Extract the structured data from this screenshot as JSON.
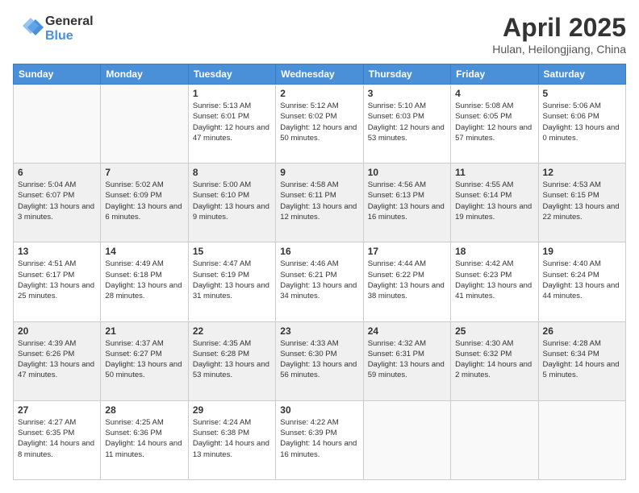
{
  "header": {
    "logo": {
      "general": "General",
      "blue": "Blue"
    },
    "title": "April 2025",
    "location": "Hulan, Heilongjiang, China"
  },
  "days_of_week": [
    "Sunday",
    "Monday",
    "Tuesday",
    "Wednesday",
    "Thursday",
    "Friday",
    "Saturday"
  ],
  "weeks": [
    [
      {
        "day": "",
        "info": ""
      },
      {
        "day": "",
        "info": ""
      },
      {
        "day": "1",
        "info": "Sunrise: 5:13 AM\nSunset: 6:01 PM\nDaylight: 12 hours and 47 minutes."
      },
      {
        "day": "2",
        "info": "Sunrise: 5:12 AM\nSunset: 6:02 PM\nDaylight: 12 hours and 50 minutes."
      },
      {
        "day": "3",
        "info": "Sunrise: 5:10 AM\nSunset: 6:03 PM\nDaylight: 12 hours and 53 minutes."
      },
      {
        "day": "4",
        "info": "Sunrise: 5:08 AM\nSunset: 6:05 PM\nDaylight: 12 hours and 57 minutes."
      },
      {
        "day": "5",
        "info": "Sunrise: 5:06 AM\nSunset: 6:06 PM\nDaylight: 13 hours and 0 minutes."
      }
    ],
    [
      {
        "day": "6",
        "info": "Sunrise: 5:04 AM\nSunset: 6:07 PM\nDaylight: 13 hours and 3 minutes."
      },
      {
        "day": "7",
        "info": "Sunrise: 5:02 AM\nSunset: 6:09 PM\nDaylight: 13 hours and 6 minutes."
      },
      {
        "day": "8",
        "info": "Sunrise: 5:00 AM\nSunset: 6:10 PM\nDaylight: 13 hours and 9 minutes."
      },
      {
        "day": "9",
        "info": "Sunrise: 4:58 AM\nSunset: 6:11 PM\nDaylight: 13 hours and 12 minutes."
      },
      {
        "day": "10",
        "info": "Sunrise: 4:56 AM\nSunset: 6:13 PM\nDaylight: 13 hours and 16 minutes."
      },
      {
        "day": "11",
        "info": "Sunrise: 4:55 AM\nSunset: 6:14 PM\nDaylight: 13 hours and 19 minutes."
      },
      {
        "day": "12",
        "info": "Sunrise: 4:53 AM\nSunset: 6:15 PM\nDaylight: 13 hours and 22 minutes."
      }
    ],
    [
      {
        "day": "13",
        "info": "Sunrise: 4:51 AM\nSunset: 6:17 PM\nDaylight: 13 hours and 25 minutes."
      },
      {
        "day": "14",
        "info": "Sunrise: 4:49 AM\nSunset: 6:18 PM\nDaylight: 13 hours and 28 minutes."
      },
      {
        "day": "15",
        "info": "Sunrise: 4:47 AM\nSunset: 6:19 PM\nDaylight: 13 hours and 31 minutes."
      },
      {
        "day": "16",
        "info": "Sunrise: 4:46 AM\nSunset: 6:21 PM\nDaylight: 13 hours and 34 minutes."
      },
      {
        "day": "17",
        "info": "Sunrise: 4:44 AM\nSunset: 6:22 PM\nDaylight: 13 hours and 38 minutes."
      },
      {
        "day": "18",
        "info": "Sunrise: 4:42 AM\nSunset: 6:23 PM\nDaylight: 13 hours and 41 minutes."
      },
      {
        "day": "19",
        "info": "Sunrise: 4:40 AM\nSunset: 6:24 PM\nDaylight: 13 hours and 44 minutes."
      }
    ],
    [
      {
        "day": "20",
        "info": "Sunrise: 4:39 AM\nSunset: 6:26 PM\nDaylight: 13 hours and 47 minutes."
      },
      {
        "day": "21",
        "info": "Sunrise: 4:37 AM\nSunset: 6:27 PM\nDaylight: 13 hours and 50 minutes."
      },
      {
        "day": "22",
        "info": "Sunrise: 4:35 AM\nSunset: 6:28 PM\nDaylight: 13 hours and 53 minutes."
      },
      {
        "day": "23",
        "info": "Sunrise: 4:33 AM\nSunset: 6:30 PM\nDaylight: 13 hours and 56 minutes."
      },
      {
        "day": "24",
        "info": "Sunrise: 4:32 AM\nSunset: 6:31 PM\nDaylight: 13 hours and 59 minutes."
      },
      {
        "day": "25",
        "info": "Sunrise: 4:30 AM\nSunset: 6:32 PM\nDaylight: 14 hours and 2 minutes."
      },
      {
        "day": "26",
        "info": "Sunrise: 4:28 AM\nSunset: 6:34 PM\nDaylight: 14 hours and 5 minutes."
      }
    ],
    [
      {
        "day": "27",
        "info": "Sunrise: 4:27 AM\nSunset: 6:35 PM\nDaylight: 14 hours and 8 minutes."
      },
      {
        "day": "28",
        "info": "Sunrise: 4:25 AM\nSunset: 6:36 PM\nDaylight: 14 hours and 11 minutes."
      },
      {
        "day": "29",
        "info": "Sunrise: 4:24 AM\nSunset: 6:38 PM\nDaylight: 14 hours and 13 minutes."
      },
      {
        "day": "30",
        "info": "Sunrise: 4:22 AM\nSunset: 6:39 PM\nDaylight: 14 hours and 16 minutes."
      },
      {
        "day": "",
        "info": ""
      },
      {
        "day": "",
        "info": ""
      },
      {
        "day": "",
        "info": ""
      }
    ]
  ]
}
